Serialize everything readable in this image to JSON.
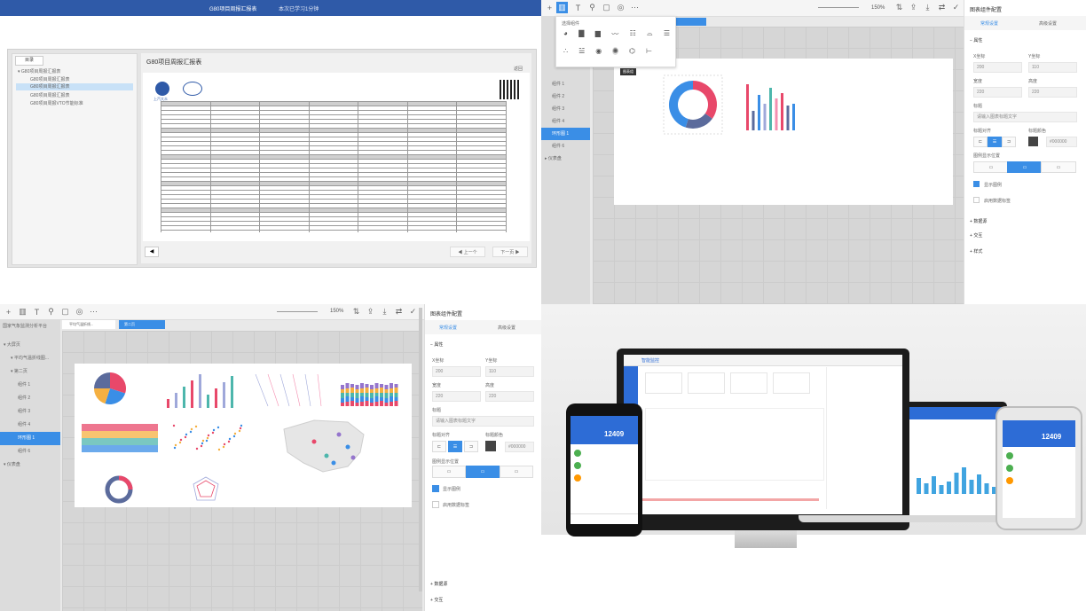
{
  "q1": {
    "header_title": "G80项目周报汇报表",
    "header_sub": "本次已学习1分钟",
    "sidebar_tab": "目录",
    "tree_root": "G80项目周报汇报表",
    "tree_items": [
      "G80项目周报汇报表",
      "G80项目周报汇报表",
      "G80项目周报汇报表",
      "G80项目周报VTO节能标准"
    ],
    "content_title": "G80项目周报汇报表",
    "return_label": "返回",
    "logo_text": "上汽大众",
    "prev_label": "◀ 上一个",
    "next_label": "下一页 ▶"
  },
  "q2": {
    "zoom": "150%",
    "popup_title": "选择组件",
    "tooltip": "图表组",
    "tab_label": "页面 1",
    "layers": [
      "组件 1",
      "组件 2",
      "组件 3",
      "组件 4",
      "环形图 1",
      "组件 6"
    ],
    "layer_group": "仪表盘",
    "panel_title": "图表组件配置",
    "tabs": [
      "常规设置",
      "高级设置"
    ],
    "section_attr": "属性",
    "fields": {
      "x_label": "X坐标",
      "y_label": "Y坐标",
      "x_value": "200",
      "y_value": "110",
      "w_label": "宽度",
      "h_label": "高度",
      "w_value": "220",
      "h_value": "220",
      "title_label": "标题",
      "title_value": "请输入图表标题文字",
      "align_label": "标题对齐",
      "color_label": "标题颜色",
      "color_value": "#000000",
      "legend_label": "图例显示位置",
      "check1": "显示图例",
      "check2": "启用数据标签"
    },
    "sections": [
      "数据源",
      "交互",
      "样式"
    ],
    "chart_colors": [
      "#e8486a",
      "#5b6b9c",
      "#3a8ee6",
      "#9fa8da",
      "#4db6ac",
      "#f48fb1"
    ]
  },
  "q3": {
    "zoom": "150%",
    "tabs": [
      "平均气温折线...",
      "第二页"
    ],
    "tree_title": "国家气象监测分析平台",
    "tree": [
      "大屏页",
      "平均气温折线图...",
      "第二页",
      "组件 1",
      "组件 2",
      "组件 3",
      "组件 4",
      "环形图 1",
      "组件 6",
      "仪表盘"
    ],
    "panel_title": "图表组件配置",
    "panel_tabs": [
      "常规设置",
      "高级设置"
    ],
    "section_attr": "属性",
    "fields": {
      "x_label": "X坐标",
      "y_label": "Y坐标",
      "x_value": "200",
      "y_value": "110",
      "w_label": "宽度",
      "h_label": "高度",
      "w_value": "220",
      "h_value": "220",
      "title_label": "标题",
      "title_value": "请输入图表标题文字",
      "align_label": "标题对齐",
      "color_label": "标题颜色",
      "color_value": "#000000",
      "legend_label": "图例显示位置",
      "check1": "显示图例",
      "check2": "启用数据标签"
    },
    "sections": [
      "数据源",
      "交互"
    ]
  },
  "q4": {
    "phone_number": "12409",
    "monitor_logo": "智能监控",
    "tablet_number": "12409"
  }
}
